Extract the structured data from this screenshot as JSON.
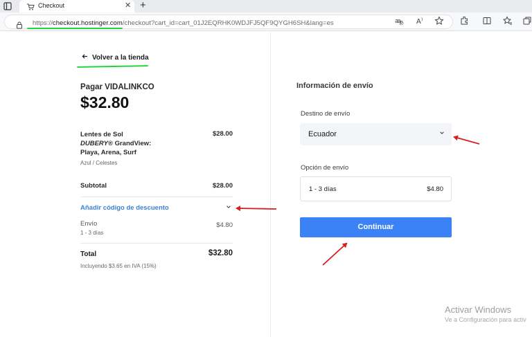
{
  "browser": {
    "tab_title": "Checkout",
    "tab_close": "✕",
    "new_tab": "+",
    "url_scheme": "https://",
    "url_host": "checkout.hostinger.com",
    "url_path": "/checkout?cart_id=cart_01J2EQRHK0WDJFJ5QF9QYGH6SH&lang=es"
  },
  "summary": {
    "back_label": "Volver a la tienda",
    "pay_to": "Pagar VIDALINKCO",
    "total_big": "$32.80",
    "item": {
      "name_line1": "Lentes de Sol",
      "name_brand": "DUBERY",
      "name_line2_rest": "® GrandView:",
      "name_line3": "Playa, Arena, Surf",
      "variant": "Azul / Celestes",
      "price": "$28.00"
    },
    "subtotal_label": "Subtotal",
    "subtotal_value": "$28.00",
    "discount_label": "Añadir código de descuento",
    "shipping_label": "Envío",
    "shipping_sub": "1 - 3 días",
    "shipping_value": "$4.80",
    "total_label": "Total",
    "total_value": "$32.80",
    "tax_note": "Incluyendo $3.65 en IVA (15%)"
  },
  "shipping_form": {
    "title": "Información de envío",
    "destination_label": "Destino de envío",
    "destination_value": "Ecuador",
    "option_label": "Opción de envío",
    "option_days": "1 - 3 días",
    "option_price": "$4.80",
    "continue_label": "Continuar"
  },
  "watermark": {
    "title": "Activar Windows",
    "subtitle": "Ve a Configuración para activ"
  },
  "colors": {
    "accent_button": "#3b82f6",
    "link_blue": "#3b82d6",
    "highlight_green": "#21d63b",
    "annotation_red": "#d42020"
  }
}
